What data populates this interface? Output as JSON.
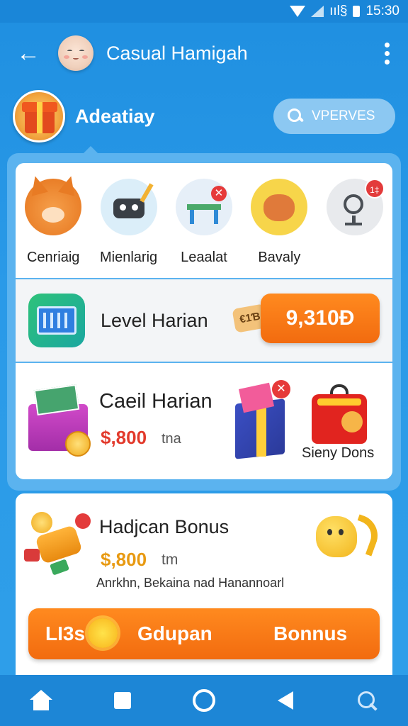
{
  "status_bar": {
    "signal_text": "ııl§",
    "time": "15:30"
  },
  "header": {
    "title": "Casual Hamigah"
  },
  "sub_header": {
    "title": "Adeatiay",
    "search_label": "VPERVES"
  },
  "categories": [
    {
      "label": "Cenriaig",
      "icon": "fox-icon"
    },
    {
      "label": "Mienlarig",
      "icon": "robot-icon"
    },
    {
      "label": "Leaalat",
      "icon": "desk-icon"
    },
    {
      "label": "Bavaly",
      "icon": "cat-icon"
    },
    {
      "label": "",
      "icon": "search-camera-icon",
      "badge": "1‡"
    }
  ],
  "level_row": {
    "title": "Level Harian",
    "ticket": "€1Ɓ",
    "value": "9,310Ð"
  },
  "ceil_row": {
    "title": "Caeil Harian",
    "price": "$,800",
    "unit": "tna",
    "pack_badge": "✕",
    "chest_label": "Sieny Dons"
  },
  "bonus_card": {
    "title": "Hadjcan Bonus",
    "price": "$,800",
    "unit": "tm",
    "description": "Anrkhn, Bekaina nad Hanannoarl",
    "button_left": "LI3s",
    "button_mid": "Gdupan",
    "button_right": "Bonnus"
  },
  "bottom_nav": [
    "home-icon",
    "square-icon",
    "circle-icon",
    "back-triangle-icon",
    "search-icon"
  ],
  "colors": {
    "primary_blue": "#1f8fe0",
    "accent_orange": "#f26b0f",
    "price_red": "#e23a2c"
  }
}
